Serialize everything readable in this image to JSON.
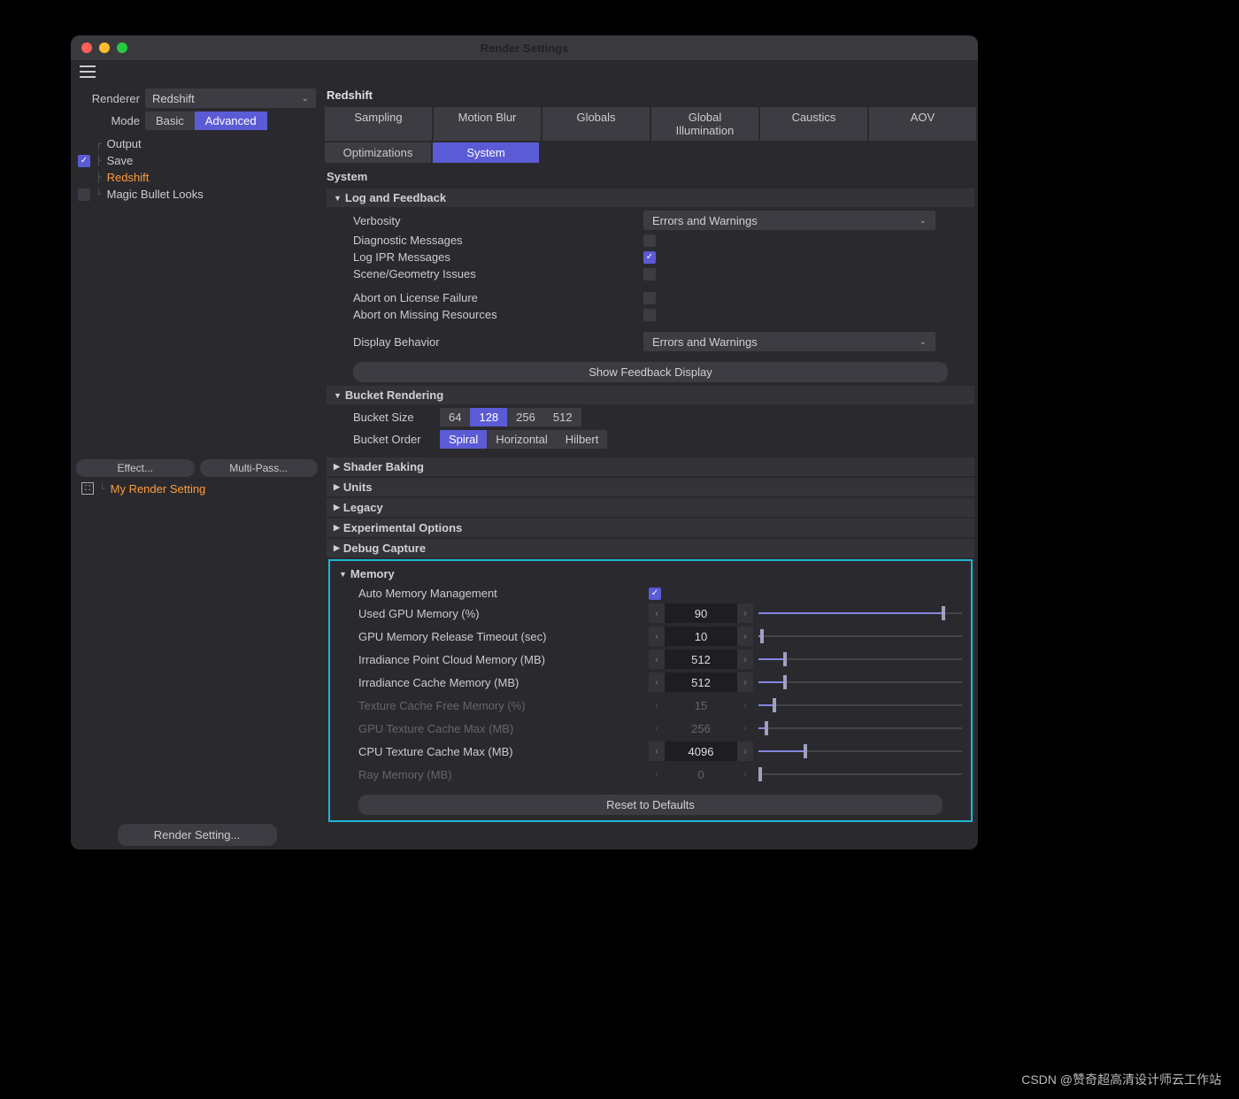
{
  "title": "Render Settings",
  "sidebar": {
    "renderer_lbl": "Renderer",
    "renderer_val": "Redshift",
    "mode_lbl": "Mode",
    "mode_basic": "Basic",
    "mode_advanced": "Advanced",
    "tree": {
      "output": "Output",
      "save": "Save",
      "redshift": "Redshift",
      "magic": "Magic Bullet Looks"
    },
    "effect": "Effect...",
    "multipass": "Multi-Pass...",
    "preset": "My Render Setting",
    "bottom": "Render Setting..."
  },
  "main": {
    "heading": "Redshift",
    "tabs1": [
      "Sampling",
      "Motion Blur",
      "Globals",
      "Global Illumination",
      "Caustics",
      "AOV"
    ],
    "tabs2": [
      "Optimizations",
      "System"
    ],
    "section": "System",
    "log": {
      "header": "Log and Feedback",
      "verbosity_lbl": "Verbosity",
      "verbosity_val": "Errors and Warnings",
      "diag": "Diagnostic Messages",
      "logipr": "Log IPR Messages",
      "scene": "Scene/Geometry Issues",
      "abort_lic": "Abort on License Failure",
      "abort_res": "Abort on Missing Resources",
      "display_lbl": "Display Behavior",
      "display_val": "Errors and Warnings",
      "show_fb": "Show Feedback Display"
    },
    "bucket": {
      "header": "Bucket Rendering",
      "size_lbl": "Bucket Size",
      "sizes": [
        "64",
        "128",
        "256",
        "512"
      ],
      "order_lbl": "Bucket Order",
      "orders": [
        "Spiral",
        "Horizontal",
        "Hilbert"
      ]
    },
    "collapsed": [
      "Shader Baking",
      "Units",
      "Legacy",
      "Experimental Options",
      "Debug Capture"
    ],
    "memory": {
      "header": "Memory",
      "auto": "Auto Memory Management",
      "rows": [
        {
          "lbl": "Used GPU Memory (%)",
          "val": "90",
          "dim": false,
          "fill": 90
        },
        {
          "lbl": "GPU Memory Release Timeout (sec)",
          "val": "10",
          "dim": false,
          "fill": 1
        },
        {
          "lbl": "Irradiance Point Cloud Memory (MB)",
          "val": "512",
          "dim": false,
          "fill": 12
        },
        {
          "lbl": "Irradiance Cache Memory (MB)",
          "val": "512",
          "dim": false,
          "fill": 12
        },
        {
          "lbl": "Texture Cache Free Memory (%)",
          "val": "15",
          "dim": true,
          "fill": 7
        },
        {
          "lbl": "GPU Texture Cache Max (MB)",
          "val": "256",
          "dim": true,
          "fill": 3
        },
        {
          "lbl": "CPU Texture Cache Max (MB)",
          "val": "4096",
          "dim": false,
          "fill": 22
        },
        {
          "lbl": "Ray Memory (MB)",
          "val": "0",
          "dim": true,
          "fill": 0
        }
      ],
      "reset": "Reset to Defaults"
    }
  },
  "watermark": "CSDN @赞奇超高清设计师云工作站"
}
